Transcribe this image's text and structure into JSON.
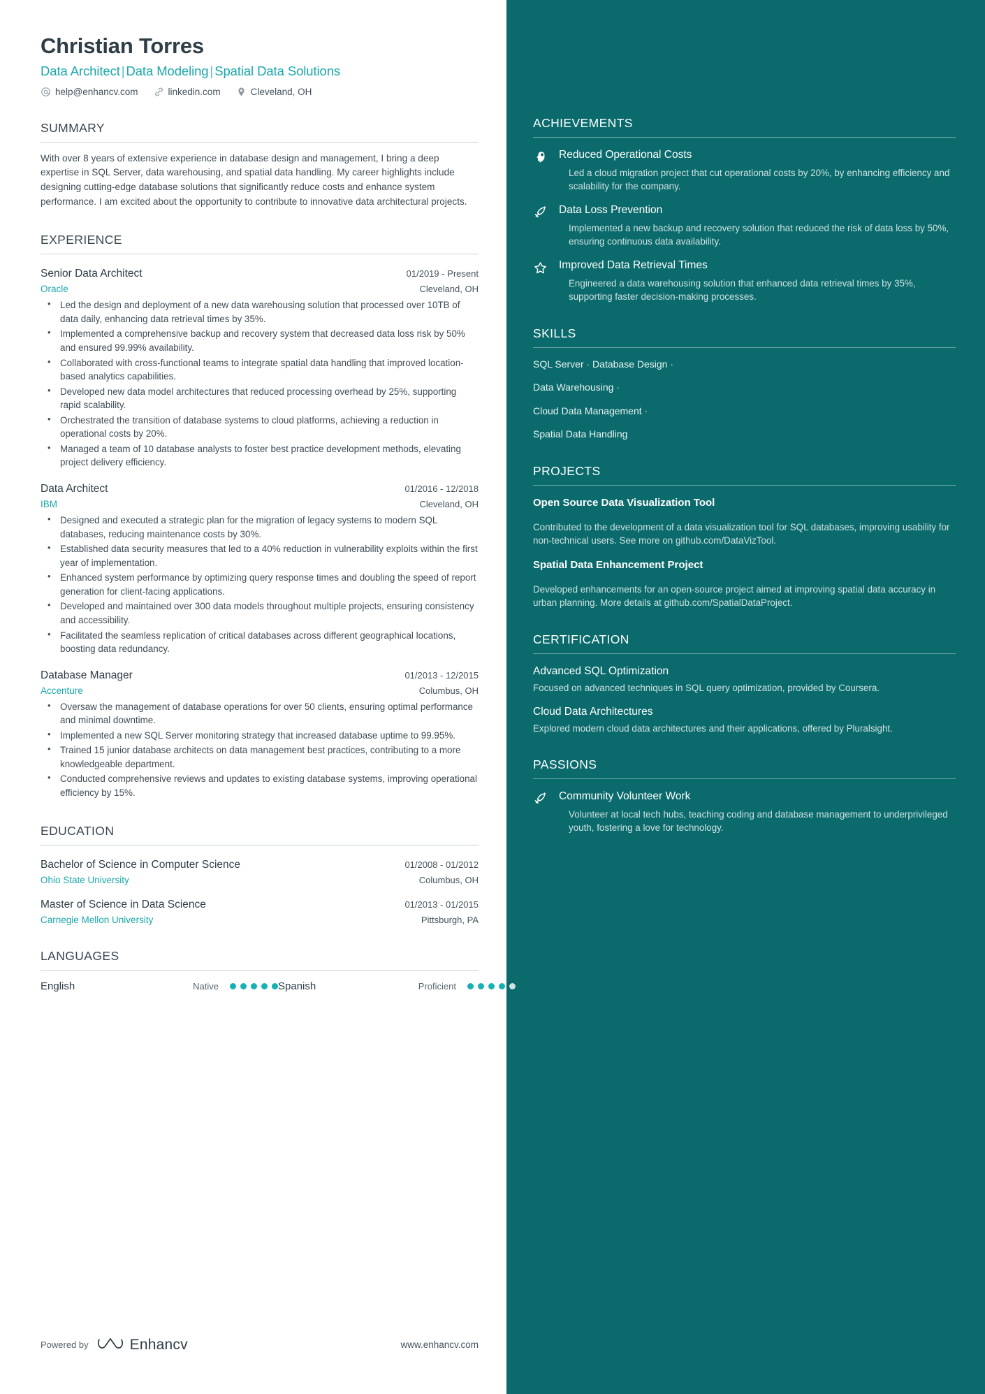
{
  "header": {
    "name": "Christian Torres",
    "tagline_parts": [
      "Data Architect",
      "Data Modeling",
      "Spatial Data Solutions"
    ],
    "separator": "|",
    "contacts": [
      {
        "icon": "at-icon",
        "text": "help@enhancv.com"
      },
      {
        "icon": "link-icon",
        "text": "linkedin.com"
      },
      {
        "icon": "location-pin-icon",
        "text": "Cleveland, OH"
      }
    ]
  },
  "summary": {
    "title": "SUMMARY",
    "text": "With over 8 years of extensive experience in database design and management, I bring a deep expertise in SQL Server, data warehousing, and spatial data handling. My career highlights include designing cutting-edge database solutions that significantly reduce costs and enhance system performance. I am excited about the opportunity to contribute to innovative data architectural projects."
  },
  "experience": {
    "title": "EXPERIENCE",
    "entries": [
      {
        "role": "Senior Data Architect",
        "date": "01/2019 - Present",
        "company": "Oracle",
        "location": "Cleveland, OH",
        "bullets": [
          "Led the design and deployment of a new data warehousing solution that processed over 10TB of data daily, enhancing data retrieval times by 35%.",
          "Implemented a comprehensive backup and recovery system that decreased data loss risk by 50% and ensured 99.99% availability.",
          "Collaborated with cross-functional teams to integrate spatial data handling that improved location-based analytics capabilities.",
          "Developed new data model architectures that reduced processing overhead by 25%, supporting rapid scalability.",
          "Orchestrated the transition of database systems to cloud platforms, achieving a reduction in operational costs by 20%.",
          "Managed a team of 10 database analysts to foster best practice development methods, elevating project delivery efficiency."
        ]
      },
      {
        "role": "Data Architect",
        "date": "01/2016 - 12/2018",
        "company": "IBM",
        "location": "Cleveland, OH",
        "bullets": [
          "Designed and executed a strategic plan for the migration of legacy systems to modern SQL databases, reducing maintenance costs by 30%.",
          "Established data security measures that led to a 40% reduction in vulnerability exploits within the first year of implementation.",
          "Enhanced system performance by optimizing query response times and doubling the speed of report generation for client-facing applications.",
          "Developed and maintained over 300 data models throughout multiple projects, ensuring consistency and accessibility.",
          "Facilitated the seamless replication of critical databases across different geographical locations, boosting data redundancy."
        ]
      },
      {
        "role": "Database Manager",
        "date": "01/2013 - 12/2015",
        "company": "Accenture",
        "location": "Columbus, OH",
        "bullets": [
          "Oversaw the management of database operations for over 50 clients, ensuring optimal performance and minimal downtime.",
          "Implemented a new SQL Server monitoring strategy that increased database uptime to 99.95%.",
          "Trained 15 junior database architects on data management best practices, contributing to a more knowledgeable department.",
          "Conducted comprehensive reviews and updates to existing database systems, improving operational efficiency by 15%."
        ]
      }
    ]
  },
  "education": {
    "title": "EDUCATION",
    "entries": [
      {
        "degree": "Bachelor of Science in Computer Science",
        "date": "01/2008 - 01/2012",
        "school": "Ohio State University",
        "location": "Columbus, OH"
      },
      {
        "degree": "Master of Science in Data Science",
        "date": "01/2013 - 01/2015",
        "school": "Carnegie Mellon University",
        "location": "Pittsburgh, PA"
      }
    ]
  },
  "languages": {
    "title": "LANGUAGES",
    "items": [
      {
        "name": "English",
        "level": "Native",
        "filled": 5,
        "total": 5
      },
      {
        "name": "Spanish",
        "level": "Proficient",
        "filled": 4,
        "total": 5
      }
    ]
  },
  "footer": {
    "powered_by": "Powered by",
    "brand": "Enhancv",
    "url": "www.enhancv.com"
  },
  "achievements": {
    "title": "ACHIEVEMENTS",
    "items": [
      {
        "icon": "head-idea-icon",
        "title": "Reduced Operational Costs",
        "desc": "Led a cloud migration project that cut operational costs by 20%, by enhancing efficiency and scalability for the company."
      },
      {
        "icon": "rocket-icon",
        "title": "Data Loss Prevention",
        "desc": "Implemented a new backup and recovery solution that reduced the risk of data loss by 50%, ensuring continuous data availability."
      },
      {
        "icon": "star-icon",
        "title": "Improved Data Retrieval Times",
        "desc": "Engineered a data warehousing solution that enhanced data retrieval times by 35%, supporting faster decision-making processes."
      }
    ]
  },
  "skills": {
    "title": "SKILLS",
    "lines": [
      "SQL Server · Database Design ·",
      "Data Warehousing ·",
      "Cloud Data Management ·",
      "Spatial Data Handling"
    ]
  },
  "projects": {
    "title": "PROJECTS",
    "items": [
      {
        "name": "Open Source Data Visualization Tool",
        "desc": "Contributed to the development of a data visualization tool for SQL databases, improving usability for non-technical users. See more on github.com/DataVizTool."
      },
      {
        "name": "Spatial Data Enhancement Project",
        "desc": "Developed enhancements for an open-source project aimed at improving spatial data accuracy in urban planning. More details at github.com/SpatialDataProject."
      }
    ]
  },
  "certification": {
    "title": "CERTIFICATION",
    "items": [
      {
        "name": "Advanced SQL Optimization",
        "desc": "Focused on advanced techniques in SQL query optimization, provided by Coursera."
      },
      {
        "name": "Cloud Data Architectures",
        "desc": "Explored modern cloud data architectures and their applications, offered by Pluralsight."
      }
    ]
  },
  "passions": {
    "title": "PASSIONS",
    "items": [
      {
        "icon": "rocket-icon",
        "title": "Community Volunteer Work",
        "desc": "Volunteer at local tech hubs, teaching coding and database management to underprivileged youth, fostering a love for technology."
      }
    ]
  },
  "colors": {
    "sidebar_bg": "#0b6a6c",
    "accent_teal": "#1aa7ab",
    "heading_dark": "#2f3d47",
    "body_text": "#404c56"
  }
}
